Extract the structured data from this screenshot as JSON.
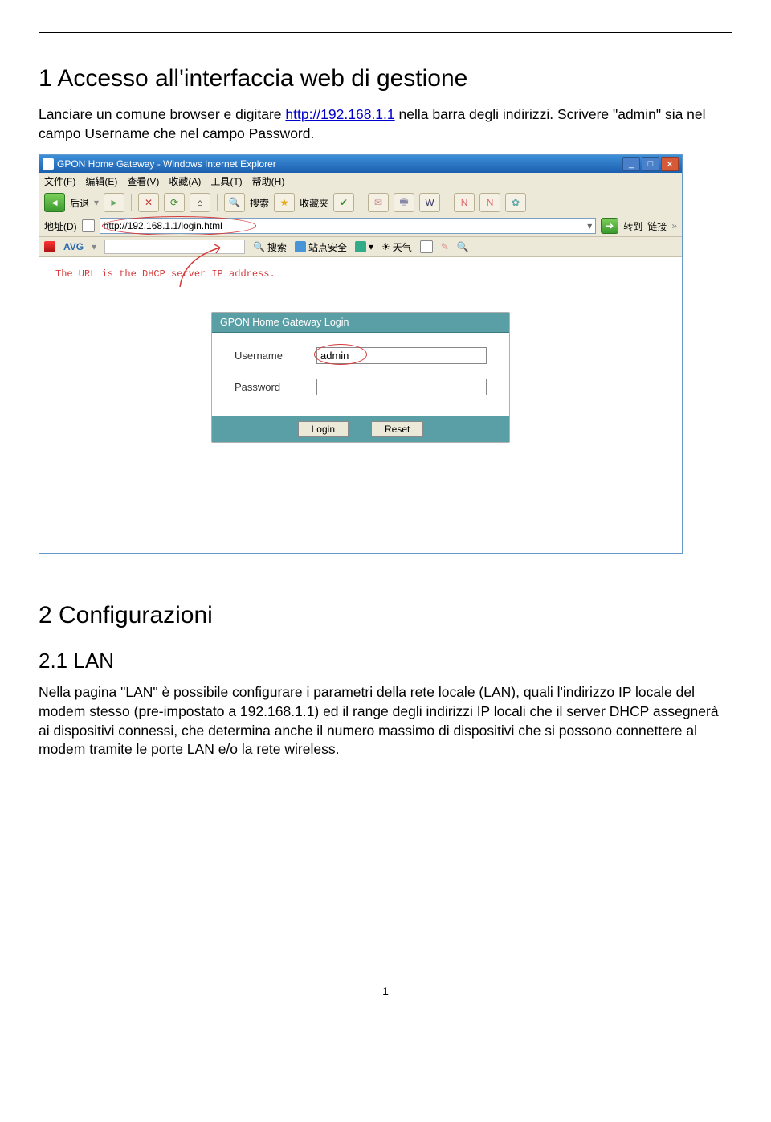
{
  "doc": {
    "section1_title": "1  Accesso all'interfaccia web di gestione",
    "para1_a": "Lanciare un comune browser e digitare ",
    "para1_link": "http://192.168.1.1",
    "para1_b": " nella barra degli indirizzi. Scrivere \"admin\" sia nel campo Username che nel campo Password.",
    "section2_title": "2  Configurazioni",
    "section2_1_title": "2.1 LAN",
    "para2": "Nella pagina \"LAN\" è possibile configurare i parametri della rete locale (LAN), quali l'indirizzo IP locale del modem stesso (pre-impostato a 192.168.1.1) ed il range degli indirizzi IP locali che il server DHCP assegnerà ai dispositivi connessi, che determina anche il numero massimo di dispositivi che si possono connettere al modem tramite le porte LAN e/o la rete wireless.",
    "page_num": "1"
  },
  "screenshot": {
    "window_title": "GPON Home Gateway - Windows Internet Explorer",
    "menus": [
      "文件(F)",
      "编辑(E)",
      "查看(V)",
      "收藏(A)",
      "工具(T)",
      "帮助(H)"
    ],
    "toolbar": {
      "back": "后退",
      "search": "搜索",
      "favorites": "收藏夹"
    },
    "address_label": "地址(D)",
    "url": "http://192.168.1.1/login.html",
    "go_label": "转到",
    "links_label": "链接",
    "avg": {
      "logo": "AVG",
      "search": "搜索",
      "site_safety": "站点安全",
      "weather": "天气"
    },
    "url_note": "The URL is the DHCP server IP address.",
    "login": {
      "header": "GPON Home Gateway Login",
      "username_label": "Username",
      "username_value": "admin",
      "password_label": "Password",
      "login_btn": "Login",
      "reset_btn": "Reset"
    }
  }
}
